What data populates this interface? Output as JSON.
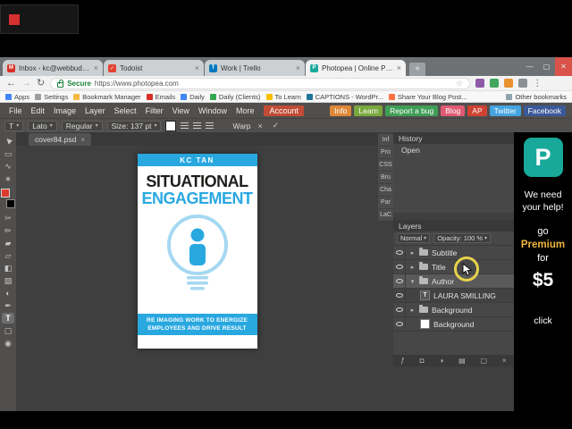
{
  "browser": {
    "tab_close": "×",
    "new_tab": "+",
    "tabs": [
      {
        "label": "Inbox - kc@webbuddy...",
        "glyph": "M",
        "color": "#d93025"
      },
      {
        "label": "Todoist",
        "glyph": "✓",
        "color": "#e44332"
      },
      {
        "label": "Work | Trello",
        "glyph": "T",
        "color": "#0079bf"
      },
      {
        "label": "Photopea | Online Photo...",
        "glyph": "P",
        "color": "#18a99b"
      }
    ],
    "window_controls": {
      "minimize": "—",
      "maximize": "▢",
      "close": "✕"
    },
    "nav": {
      "back": "←",
      "forward": "→",
      "refresh": "↻"
    },
    "address": {
      "secure": "Secure",
      "url": "https://www.photopea.com",
      "star": "☆",
      "menu": "⋮"
    },
    "extensions": [
      {
        "color": "#8e5aa8"
      },
      {
        "color": "#3fa65c"
      },
      {
        "color": "#e8912d"
      },
      {
        "color": "#8a9096"
      }
    ],
    "bookmarks": [
      {
        "label": "Apps",
        "color": "#4285f4"
      },
      {
        "label": "Settings",
        "color": "#9e9e9e"
      },
      {
        "label": "Bookmark Manager",
        "color": "#f5b942"
      },
      {
        "label": "Emails",
        "color": "#d93025"
      },
      {
        "label": "Daily",
        "color": "#4285f4"
      },
      {
        "label": "Daily (Clients)",
        "color": "#34a853"
      },
      {
        "label": "To Learn",
        "color": "#fbbc05"
      },
      {
        "label": "CAPTIONS - WordPr...",
        "color": "#21759b"
      },
      {
        "label": "Share Your Blog Post...",
        "color": "#ff7043"
      }
    ],
    "other_bookmarks": "Other bookmarks"
  },
  "menubar": {
    "items": [
      "File",
      "Edit",
      "Image",
      "Layer",
      "Select",
      "Filter",
      "View",
      "Window",
      "More"
    ],
    "account": "Account",
    "account_color": "#c14c35",
    "buttons": [
      {
        "label": "Info",
        "color": "#e0883a"
      },
      {
        "label": "Learn",
        "color": "#79a83d"
      },
      {
        "label": "Report a bug",
        "color": "#3f9e56"
      },
      {
        "label": "Blog",
        "color": "#e05a74"
      },
      {
        "label": "AP",
        "color": "#cf4232"
      },
      {
        "label": "Twitter",
        "color": "#45a4e0"
      },
      {
        "label": "Facebook",
        "color": "#3b5998"
      }
    ]
  },
  "options": {
    "tool_glyph": "T",
    "caret": "▾",
    "font_family": "Lato",
    "font_style": "Regular",
    "size": "Size: 137 pt",
    "warp": "Warp",
    "cancel": "×",
    "commit": "✓"
  },
  "toolbar": {
    "fg_color": "#dc3a2c",
    "bg_color": "#000000",
    "tools_top": [
      {
        "glyph": "▶"
      },
      {
        "glyph": "▭"
      },
      {
        "glyph": "∿"
      },
      {
        "glyph": "∗"
      }
    ],
    "tools_bottom": [
      {
        "glyph": "✂"
      },
      {
        "glyph": "✏"
      },
      {
        "glyph": "▰"
      },
      {
        "glyph": "▱"
      },
      {
        "glyph": "◧"
      },
      {
        "glyph": "▨"
      },
      {
        "glyph": "◐"
      },
      {
        "glyph": "✒"
      },
      {
        "glyph": "T"
      },
      {
        "glyph": "▢"
      },
      {
        "glyph": "◉"
      }
    ]
  },
  "document": {
    "tab": "cover84.psd",
    "close": "×"
  },
  "book": {
    "author": "KC TAN",
    "title1": "SITUATIONAL",
    "title2": "ENGAGEMENT",
    "sub1": "RE IMAGING WORK TO ENERGIZE",
    "sub2": "EMPLOYEES AND DRIVE RESULT",
    "accent": "#29a8e0",
    "accent_light": "#a5d8f2"
  },
  "side_tabs": [
    "Inf",
    "Pro",
    "CSS",
    "Bru",
    "Cha",
    "Par",
    "LaC"
  ],
  "history": {
    "title": "History",
    "items": [
      "Open"
    ]
  },
  "layers": {
    "title": "Layers",
    "blend": "Normal",
    "opacity": "Opacity: 100 %",
    "caret": "▾",
    "rows": [
      {
        "name": "Subtitle",
        "twisty": "▸"
      },
      {
        "name": "Title",
        "twisty": "▸"
      },
      {
        "name": "Author",
        "twisty": "▾"
      },
      {
        "name": "LAURA SMILLING",
        "thumb": "T"
      },
      {
        "name": "Background",
        "twisty": "▸"
      },
      {
        "name": "Background"
      }
    ],
    "bottom_icons": [
      "ƒ",
      "◘",
      "◑",
      "▤",
      "▢",
      "×"
    ]
  },
  "promo": {
    "logo": "P",
    "logo_color": "#18a99b",
    "line1": "We need",
    "line2": "your help!",
    "go": "go",
    "premium": "Premium",
    "premium_color": "#f0b73f",
    "for": "for",
    "price": "$5",
    "click": "click"
  }
}
